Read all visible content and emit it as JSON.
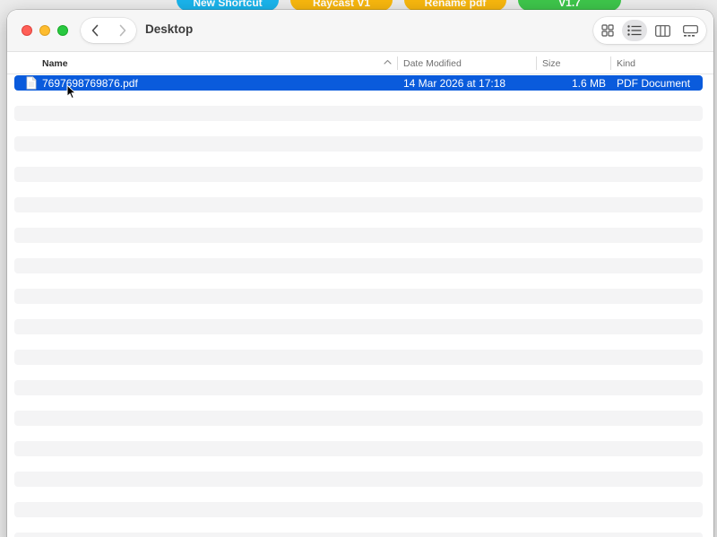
{
  "background_app": {
    "shortcuts": [
      {
        "label": "New Shortcut",
        "color": "#1ab4ec"
      },
      {
        "label": "Raycast V1",
        "color": "#f8b70e"
      },
      {
        "label": "Rename pdf",
        "color": "#f8b70e"
      },
      {
        "label": "V1.7",
        "color": "#3ec64b"
      }
    ]
  },
  "window": {
    "title": "Desktop",
    "nav": {
      "back_icon": "chevron-left-icon",
      "forward_icon": "chevron-right-icon"
    },
    "view_modes": {
      "selected": "list",
      "icons": [
        "icon-view-icon",
        "list-view-icon",
        "column-view-icon",
        "gallery-view-icon"
      ]
    },
    "columns": {
      "name": "Name",
      "date_modified": "Date Modified",
      "size": "Size",
      "kind": "Kind"
    },
    "sort": {
      "column": "name",
      "direction": "ascending"
    },
    "files": [
      {
        "name": "7697698769876.pdf",
        "date_modified": "14 Mar 2026 at 17:18",
        "size": "1.6 MB",
        "kind": "PDF Document",
        "icon": "pdf-file-icon",
        "selected": true
      }
    ],
    "colors": {
      "selection": "#0a5bdc",
      "stripe": "#f4f4f5",
      "close": "#ff5f57",
      "minimize": "#febc2e",
      "maximize": "#28c840"
    }
  }
}
